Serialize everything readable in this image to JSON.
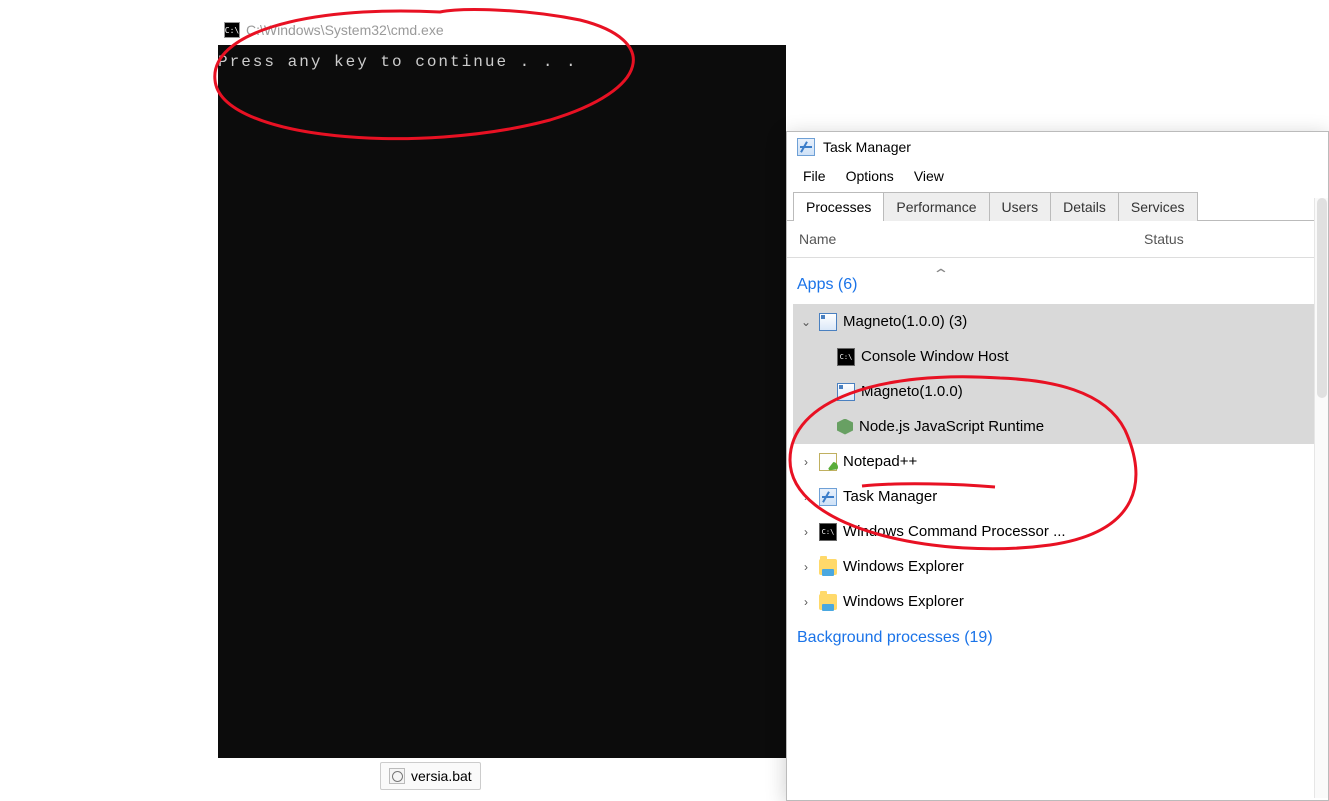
{
  "cmd": {
    "title": "C:\\Windows\\System32\\cmd.exe",
    "body_text": "Press any key to continue . . ."
  },
  "task_manager": {
    "title": "Task Manager",
    "menu": {
      "file": "File",
      "options": "Options",
      "view": "View"
    },
    "tabs": {
      "processes": "Processes",
      "performance": "Performance",
      "users": "Users",
      "details": "Details",
      "services": "Services"
    },
    "columns": {
      "name": "Name",
      "status": "Status"
    },
    "sections": {
      "apps": {
        "label": "Apps (6)"
      },
      "background": {
        "label": "Background processes (19)"
      }
    },
    "apps": [
      {
        "name": "Magneto(1.0.0) (3)",
        "icon": "app",
        "expanded": true,
        "selected": true,
        "children": [
          {
            "name": "Console Window Host",
            "icon": "cmd"
          },
          {
            "name": "Magneto(1.0.0)",
            "icon": "app"
          },
          {
            "name": "Node.js JavaScript Runtime",
            "icon": "node"
          }
        ]
      },
      {
        "name": "Notepad++",
        "icon": "npp",
        "expanded": false
      },
      {
        "name": "Task Manager",
        "icon": "tm",
        "expanded": false
      },
      {
        "name": "Windows Command Processor ...",
        "icon": "cmd",
        "expanded": false
      },
      {
        "name": "Windows Explorer",
        "icon": "folder",
        "expanded": false
      },
      {
        "name": "Windows Explorer",
        "icon": "folder",
        "expanded": false
      }
    ]
  },
  "taskbar": {
    "item_label": "versia.bat"
  }
}
